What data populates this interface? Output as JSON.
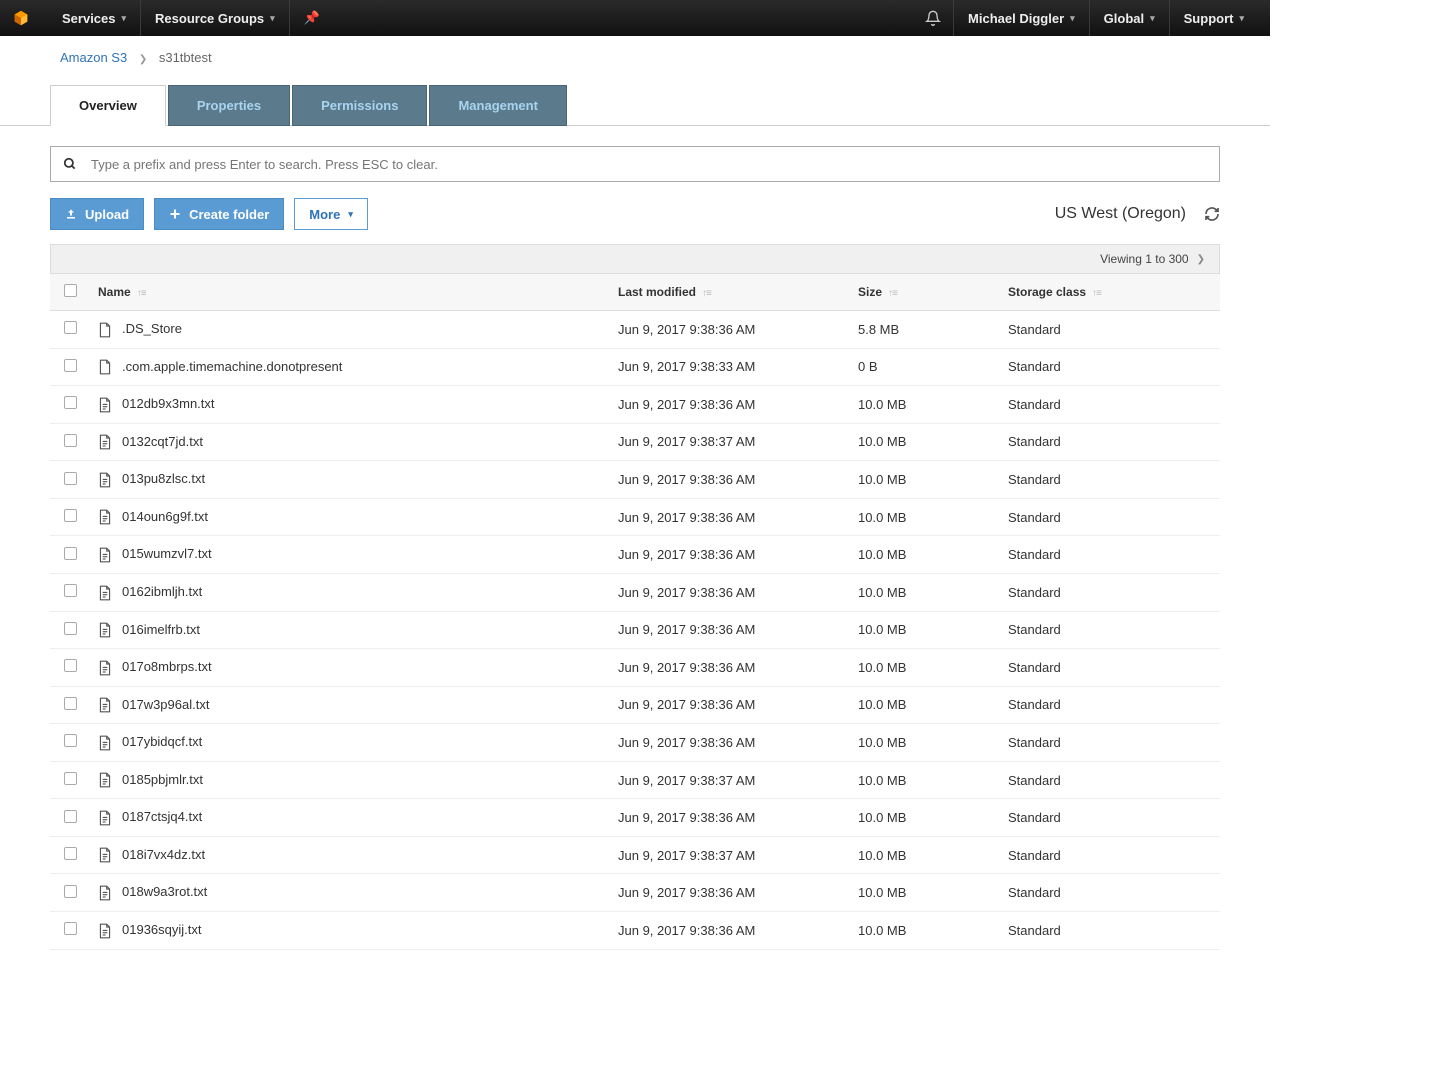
{
  "topbar": {
    "services": "Services",
    "resource_groups": "Resource Groups",
    "user": "Michael Diggler",
    "region": "Global",
    "support": "Support"
  },
  "breadcrumb": {
    "root": "Amazon S3",
    "bucket": "s31tbtest"
  },
  "tabs": {
    "overview": "Overview",
    "properties": "Properties",
    "permissions": "Permissions",
    "management": "Management"
  },
  "search": {
    "placeholder": "Type a prefix and press Enter to search. Press ESC to clear."
  },
  "buttons": {
    "upload": "Upload",
    "create_folder": "Create folder",
    "more": "More"
  },
  "region_label": "US West (Oregon)",
  "viewing": "Viewing 1 to 300",
  "columns": {
    "name": "Name",
    "modified": "Last modified",
    "size": "Size",
    "storage": "Storage class"
  },
  "rows": [
    {
      "icon": "file",
      "name": ".DS_Store",
      "modified": "Jun 9, 2017 9:38:36 AM",
      "size": "5.8 MB",
      "storage": "Standard"
    },
    {
      "icon": "file",
      "name": ".com.apple.timemachine.donotpresent",
      "modified": "Jun 9, 2017 9:38:33 AM",
      "size": "0 B",
      "storage": "Standard"
    },
    {
      "icon": "doc",
      "name": "012db9x3mn.txt",
      "modified": "Jun 9, 2017 9:38:36 AM",
      "size": "10.0 MB",
      "storage": "Standard"
    },
    {
      "icon": "doc",
      "name": "0132cqt7jd.txt",
      "modified": "Jun 9, 2017 9:38:37 AM",
      "size": "10.0 MB",
      "storage": "Standard"
    },
    {
      "icon": "doc",
      "name": "013pu8zlsc.txt",
      "modified": "Jun 9, 2017 9:38:36 AM",
      "size": "10.0 MB",
      "storage": "Standard"
    },
    {
      "icon": "doc",
      "name": "014oun6g9f.txt",
      "modified": "Jun 9, 2017 9:38:36 AM",
      "size": "10.0 MB",
      "storage": "Standard"
    },
    {
      "icon": "doc",
      "name": "015wumzvl7.txt",
      "modified": "Jun 9, 2017 9:38:36 AM",
      "size": "10.0 MB",
      "storage": "Standard"
    },
    {
      "icon": "doc",
      "name": "0162ibmljh.txt",
      "modified": "Jun 9, 2017 9:38:36 AM",
      "size": "10.0 MB",
      "storage": "Standard"
    },
    {
      "icon": "doc",
      "name": "016imelfrb.txt",
      "modified": "Jun 9, 2017 9:38:36 AM",
      "size": "10.0 MB",
      "storage": "Standard"
    },
    {
      "icon": "doc",
      "name": "017o8mbrps.txt",
      "modified": "Jun 9, 2017 9:38:36 AM",
      "size": "10.0 MB",
      "storage": "Standard"
    },
    {
      "icon": "doc",
      "name": "017w3p96al.txt",
      "modified": "Jun 9, 2017 9:38:36 AM",
      "size": "10.0 MB",
      "storage": "Standard"
    },
    {
      "icon": "doc",
      "name": "017ybidqcf.txt",
      "modified": "Jun 9, 2017 9:38:36 AM",
      "size": "10.0 MB",
      "storage": "Standard"
    },
    {
      "icon": "doc",
      "name": "0185pbjmlr.txt",
      "modified": "Jun 9, 2017 9:38:37 AM",
      "size": "10.0 MB",
      "storage": "Standard"
    },
    {
      "icon": "doc",
      "name": "0187ctsjq4.txt",
      "modified": "Jun 9, 2017 9:38:36 AM",
      "size": "10.0 MB",
      "storage": "Standard"
    },
    {
      "icon": "doc",
      "name": "018i7vx4dz.txt",
      "modified": "Jun 9, 2017 9:38:37 AM",
      "size": "10.0 MB",
      "storage": "Standard"
    },
    {
      "icon": "doc",
      "name": "018w9a3rot.txt",
      "modified": "Jun 9, 2017 9:38:36 AM",
      "size": "10.0 MB",
      "storage": "Standard"
    },
    {
      "icon": "doc",
      "name": "01936sqyij.txt",
      "modified": "Jun 9, 2017 9:38:36 AM",
      "size": "10.0 MB",
      "storage": "Standard"
    }
  ]
}
